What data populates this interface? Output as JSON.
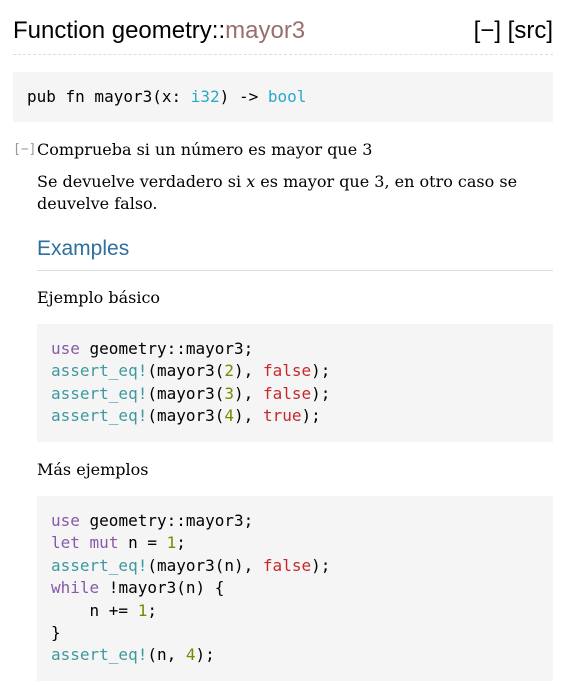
{
  "header": {
    "kind": "Function",
    "path": "geometry::",
    "name": "mayor3",
    "collapse_label": "[−]",
    "src_label": "[src]"
  },
  "signature": {
    "prefix": "pub fn mayor3(x: ",
    "arg_type": "i32",
    "middle": ") -> ",
    "ret_type": "bool"
  },
  "docblock": {
    "toggle_label": "[−]",
    "summary": "Comprueba si un número es mayor que 3",
    "desc_before": "Se devuelve verdadero si ",
    "desc_var": "x",
    "desc_after": " es mayor que 3, en otro caso se deuvelve falso.",
    "examples_heading": "Examples",
    "example1_label": "Ejemplo básico",
    "example2_label": "Más ejemplos"
  },
  "example1": [
    [
      [
        "kw",
        "use"
      ],
      [
        "plain",
        " geometry::mayor3;"
      ]
    ],
    [
      [
        "macro",
        "assert_eq!"
      ],
      [
        "plain",
        "(mayor3("
      ],
      [
        "num",
        "2"
      ],
      [
        "plain",
        "), "
      ],
      [
        "bool",
        "false"
      ],
      [
        "plain",
        ");"
      ]
    ],
    [
      [
        "macro",
        "assert_eq!"
      ],
      [
        "plain",
        "(mayor3("
      ],
      [
        "num",
        "3"
      ],
      [
        "plain",
        "), "
      ],
      [
        "bool",
        "false"
      ],
      [
        "plain",
        ");"
      ]
    ],
    [
      [
        "macro",
        "assert_eq!"
      ],
      [
        "plain",
        "(mayor3("
      ],
      [
        "num",
        "4"
      ],
      [
        "plain",
        "), "
      ],
      [
        "bool",
        "true"
      ],
      [
        "plain",
        ");"
      ]
    ]
  ],
  "example2": [
    [
      [
        "kw",
        "use"
      ],
      [
        "plain",
        " geometry::mayor3;"
      ]
    ],
    [
      [
        "kw",
        "let"
      ],
      [
        "plain",
        " "
      ],
      [
        "kw",
        "mut"
      ],
      [
        "plain",
        " n = "
      ],
      [
        "num",
        "1"
      ],
      [
        "plain",
        ";"
      ]
    ],
    [
      [
        "macro",
        "assert_eq!"
      ],
      [
        "plain",
        "(mayor3(n), "
      ],
      [
        "bool",
        "false"
      ],
      [
        "plain",
        ");"
      ]
    ],
    [
      [
        "kw",
        "while"
      ],
      [
        "plain",
        " !mayor3(n) {"
      ]
    ],
    [
      [
        "plain",
        "    n += "
      ],
      [
        "num",
        "1"
      ],
      [
        "plain",
        ";"
      ]
    ],
    [
      [
        "plain",
        "}"
      ]
    ],
    [
      [
        "macro",
        "assert_eq!"
      ],
      [
        "plain",
        "(n, "
      ],
      [
        "num",
        "4"
      ],
      [
        "plain",
        ");"
      ]
    ]
  ],
  "colors": {
    "function_name": "#9a6e6e",
    "type": "#2aa8c9",
    "keyword": "#8959a8",
    "macro": "#3e999f",
    "number": "#718c00",
    "boolean": "#c82829",
    "heading": "#2d6f9e"
  }
}
